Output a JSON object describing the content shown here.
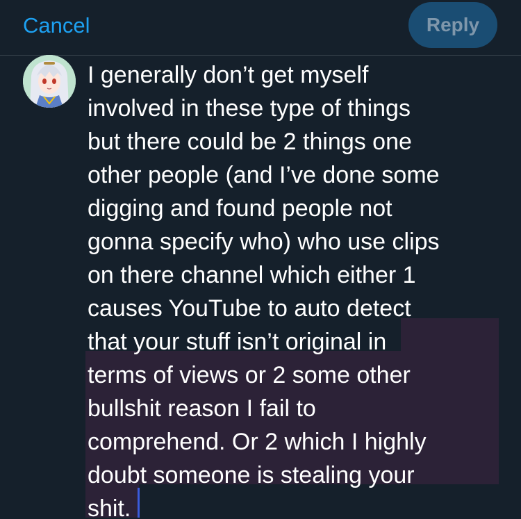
{
  "header": {
    "cancel_label": "Cancel",
    "reply_label": "Reply"
  },
  "composer": {
    "lines": [
      "I generally don’t get myself",
      "involved in these type of things",
      "but there could be 2 things one",
      "other people (and I’ve done some",
      "digging and found people not",
      "gonna specify who) who use clips",
      "on there channel which either 1",
      "causes YouTube to auto detect",
      "that your stuff isn’t original in",
      "terms of views or 2 some other",
      "bullshit reason I fail to",
      "comprehend. Or 2 which I highly",
      "doubt someone is stealing your",
      "shit."
    ]
  },
  "colors": {
    "background": "#15202b",
    "accent": "#1da1f2",
    "reply_button": "#1a4d73",
    "selection": "#2c2237"
  },
  "icons": {
    "avatar": "anime-avatar"
  }
}
